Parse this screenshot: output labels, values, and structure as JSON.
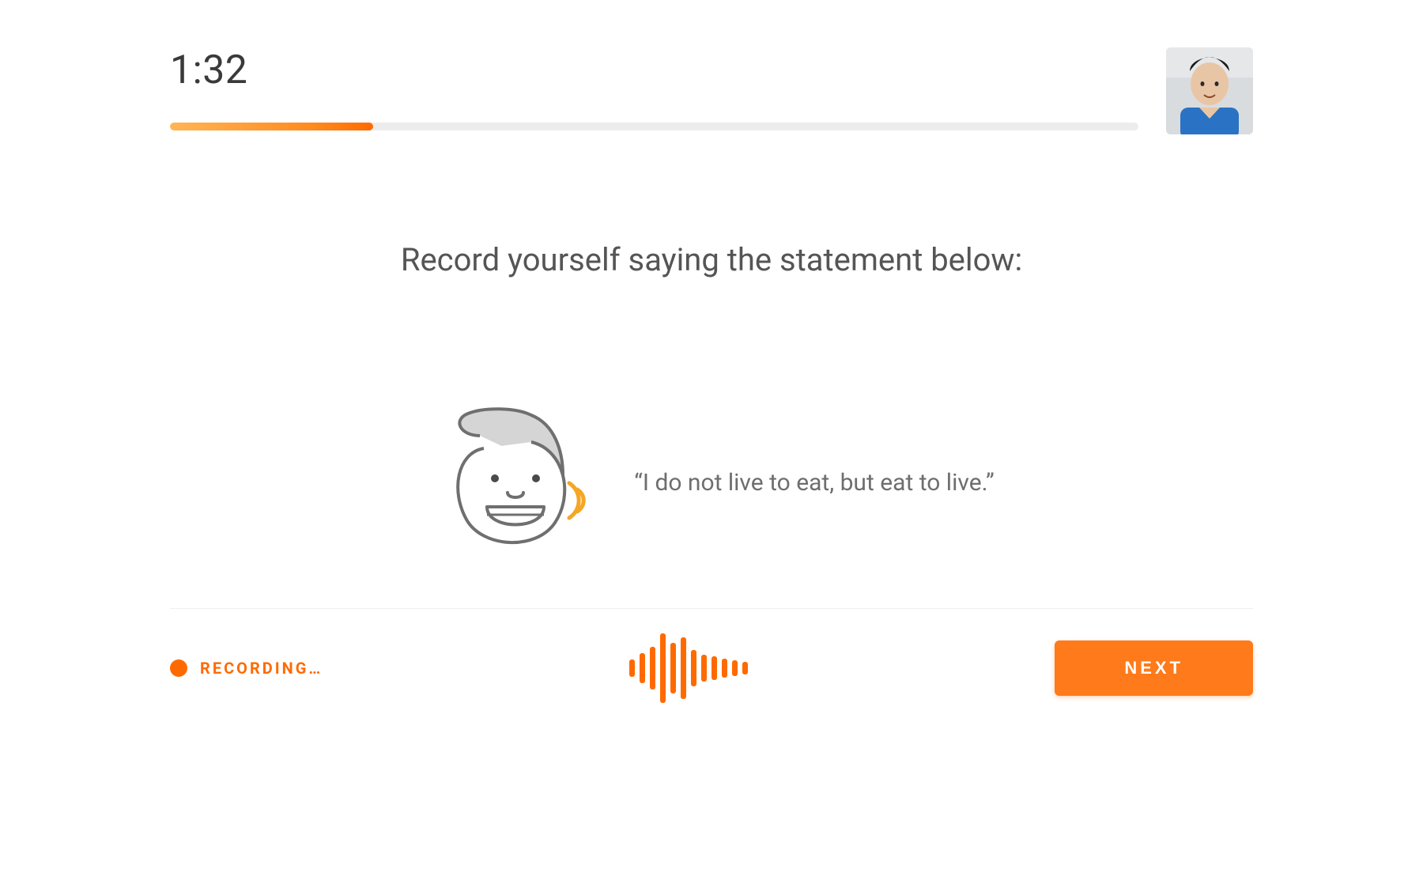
{
  "timer": "1:32",
  "progress_percent": 21,
  "instruction": "Record yourself saying the statement below:",
  "prompt": "“I do not live to eat, but eat to live.”",
  "footer": {
    "recording_label": "RECORDING…",
    "next_label": "NEXT"
  },
  "colors": {
    "accent": "#ff6a00",
    "accent_light": "#ffb555",
    "text": "#4a4a4a"
  },
  "icons": {
    "face": "speaking-face-icon",
    "waveform": "audio-waveform-icon",
    "avatar": "user-avatar"
  }
}
